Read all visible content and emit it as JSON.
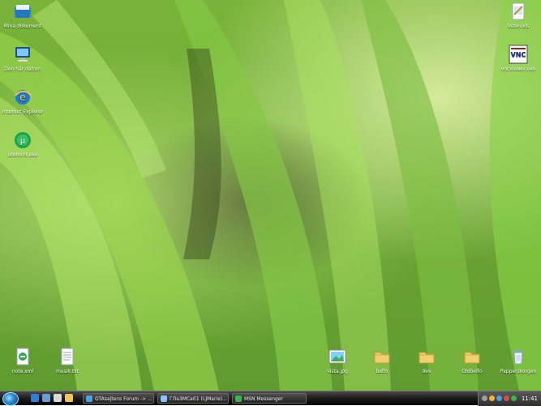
{
  "desktop_icons": {
    "my_documents": "Mina dokument",
    "this_computer": "Den här datorn",
    "internet_explorer": "Internet Explorer",
    "utorrent": "utorrent.exe",
    "listen": "listen.xls",
    "vncviewer": "vncviewer.exe",
    "note": "note.xml",
    "musik": "musik.txt",
    "vista": "vista.jpg",
    "belfo": "belfo",
    "dev": "dev",
    "oldbelfo": "Oldbelfo",
    "recycle": "Papperskorgen"
  },
  "taskbar": {
    "tasks": [
      "GTAsajtens Forum -> ...",
      "ГЛаЗМСаЄ1 (LJMarie)...",
      "MSN Messenger"
    ],
    "clock": "11:41"
  }
}
